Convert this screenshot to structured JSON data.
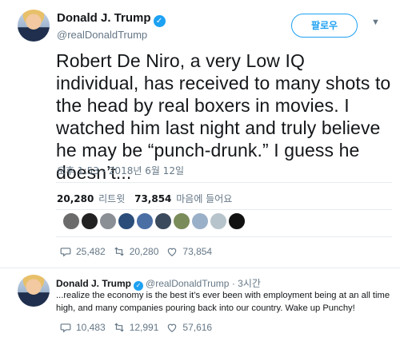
{
  "tweet": {
    "author_name": "Donald J. Trump",
    "author_handle": "@realDonaldTrump",
    "follow_label": "팔로우",
    "text": "Robert De Niro, a very Low IQ individual, has received to many shots to the head by real boxers in movies. I watched him last night and truly believe he may be “punch-drunk.” I guess he doesn’t...",
    "timestamp": "오후 1:53 - 2018년 6월 12일",
    "stats": {
      "retweets_count": "20,280",
      "retweets_label": "리트윗",
      "likes_count": "73,854",
      "likes_label": "마음에 들어요"
    },
    "likers": [
      "#6b6b6b",
      "#222222",
      "#8a8f96",
      "#2a4d7a",
      "#4a6fa5",
      "#3b4a5c",
      "#7a8c5a",
      "#9ab0c8",
      "#b8c4cc",
      "#111111"
    ],
    "actions": {
      "replies": "25,482",
      "retweets": "20,280",
      "likes": "73,854"
    }
  },
  "reply": {
    "author_name": "Donald J. Trump",
    "author_handle": "@realDonaldTrump",
    "time": "· 3시간",
    "text": "...realize the economy is the best it’s ever been with employment being at an all time high, and many companies pouring back into our country. Wake up Punchy!",
    "actions": {
      "replies": "10,483",
      "retweets": "12,991",
      "likes": "57,616"
    }
  },
  "colors": {
    "accent": "#1da1f2",
    "secondary_text": "#657786",
    "divider": "#e6ecf0"
  },
  "icons": [
    "verified-badge-icon",
    "chevron-down-icon",
    "reply-icon",
    "retweet-icon",
    "heart-icon"
  ]
}
